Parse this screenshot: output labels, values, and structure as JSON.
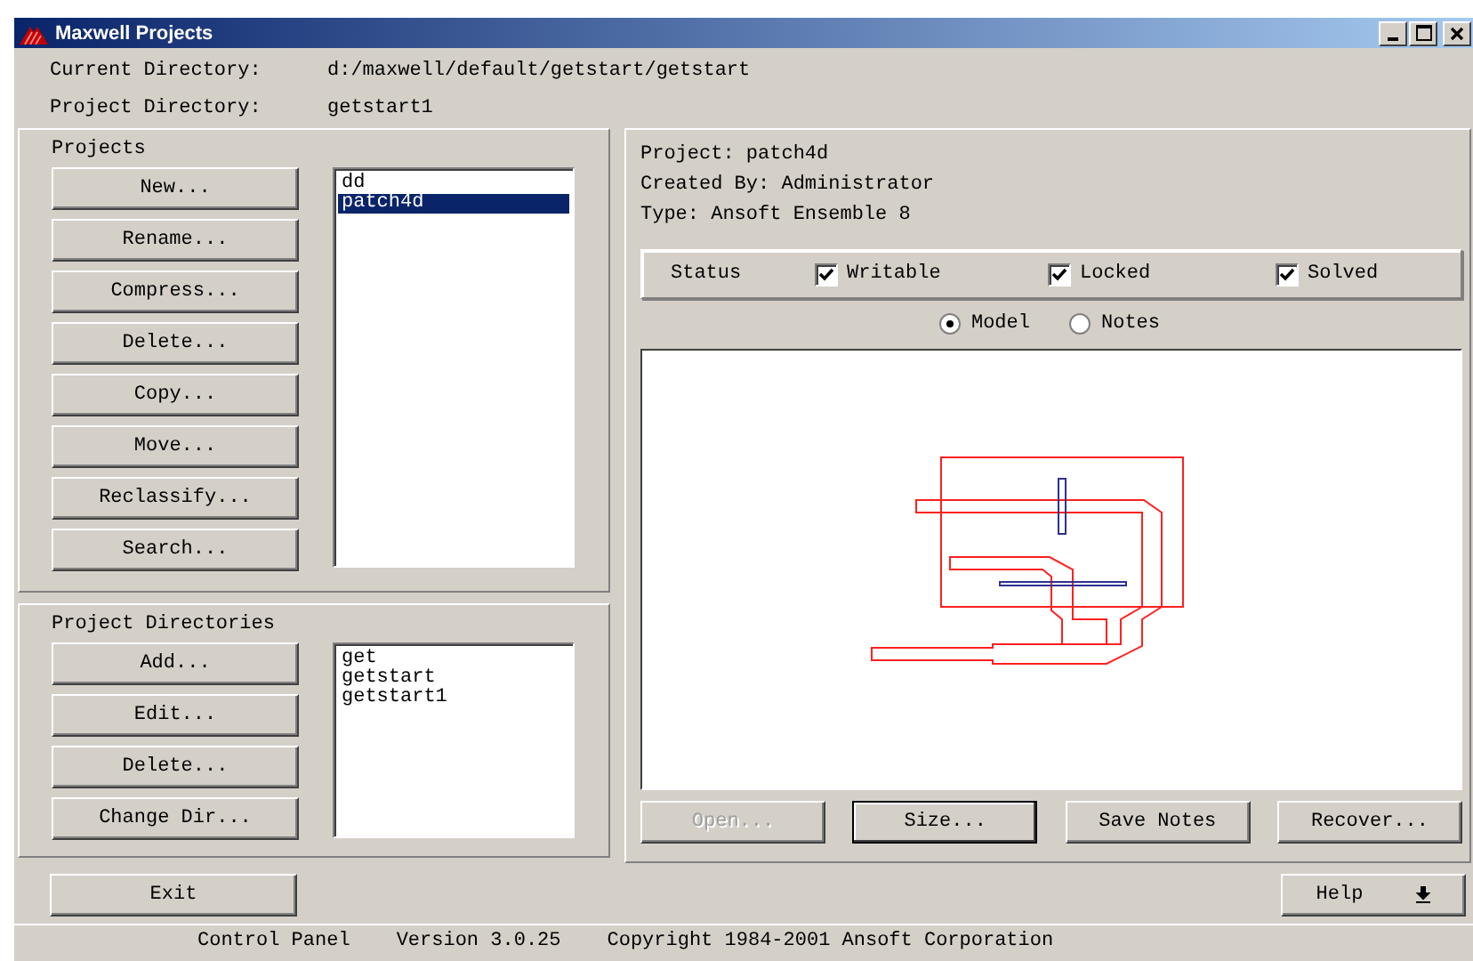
{
  "window": {
    "title": "Maxwell Projects"
  },
  "info": [
    {
      "label": "Current Directory:",
      "value": "d:/maxwell/default/getstart/getstart"
    },
    {
      "label": "Project Directory:",
      "value": "getstart1"
    }
  ],
  "projects": {
    "title": "Projects",
    "buttons": [
      "New...",
      "Rename...",
      "Compress...",
      "Delete...",
      "Copy...",
      "Move...",
      "Reclassify...",
      "Search..."
    ],
    "list": [
      {
        "label": "dd",
        "selected": false
      },
      {
        "label": "patch4d",
        "selected": true
      }
    ]
  },
  "project_directories": {
    "title": "Project Directories",
    "buttons": [
      "Add...",
      "Edit...",
      "Delete...",
      "Change Dir..."
    ],
    "list": [
      {
        "label": "get",
        "selected": false
      },
      {
        "label": "getstart",
        "selected": false
      },
      {
        "label": "getstart1",
        "selected": false
      }
    ]
  },
  "details": {
    "lines": [
      "Project: patch4d",
      "Created By: Administrator",
      "Type: Ansoft Ensemble 8"
    ],
    "status": {
      "label": "Status",
      "checks": [
        {
          "label": "Writable",
          "checked": true
        },
        {
          "label": "Locked",
          "checked": true
        },
        {
          "label": "Solved",
          "checked": true
        }
      ]
    },
    "views": [
      {
        "label": "Model",
        "selected": true
      },
      {
        "label": "Notes",
        "selected": false
      }
    ],
    "buttons": [
      {
        "label": "Open...",
        "disabled": true,
        "focused": false
      },
      {
        "label": "Size...",
        "disabled": false,
        "focused": true
      },
      {
        "label": "Save Notes",
        "disabled": false,
        "focused": false
      },
      {
        "label": "Recover...",
        "disabled": false,
        "focused": false
      }
    ]
  },
  "footer": {
    "exit": "Exit",
    "help": "Help"
  },
  "status_bar": [
    "Control Panel",
    "Version 3.0.25",
    "Copyright 1984-2001 Ansoft Corporation"
  ]
}
